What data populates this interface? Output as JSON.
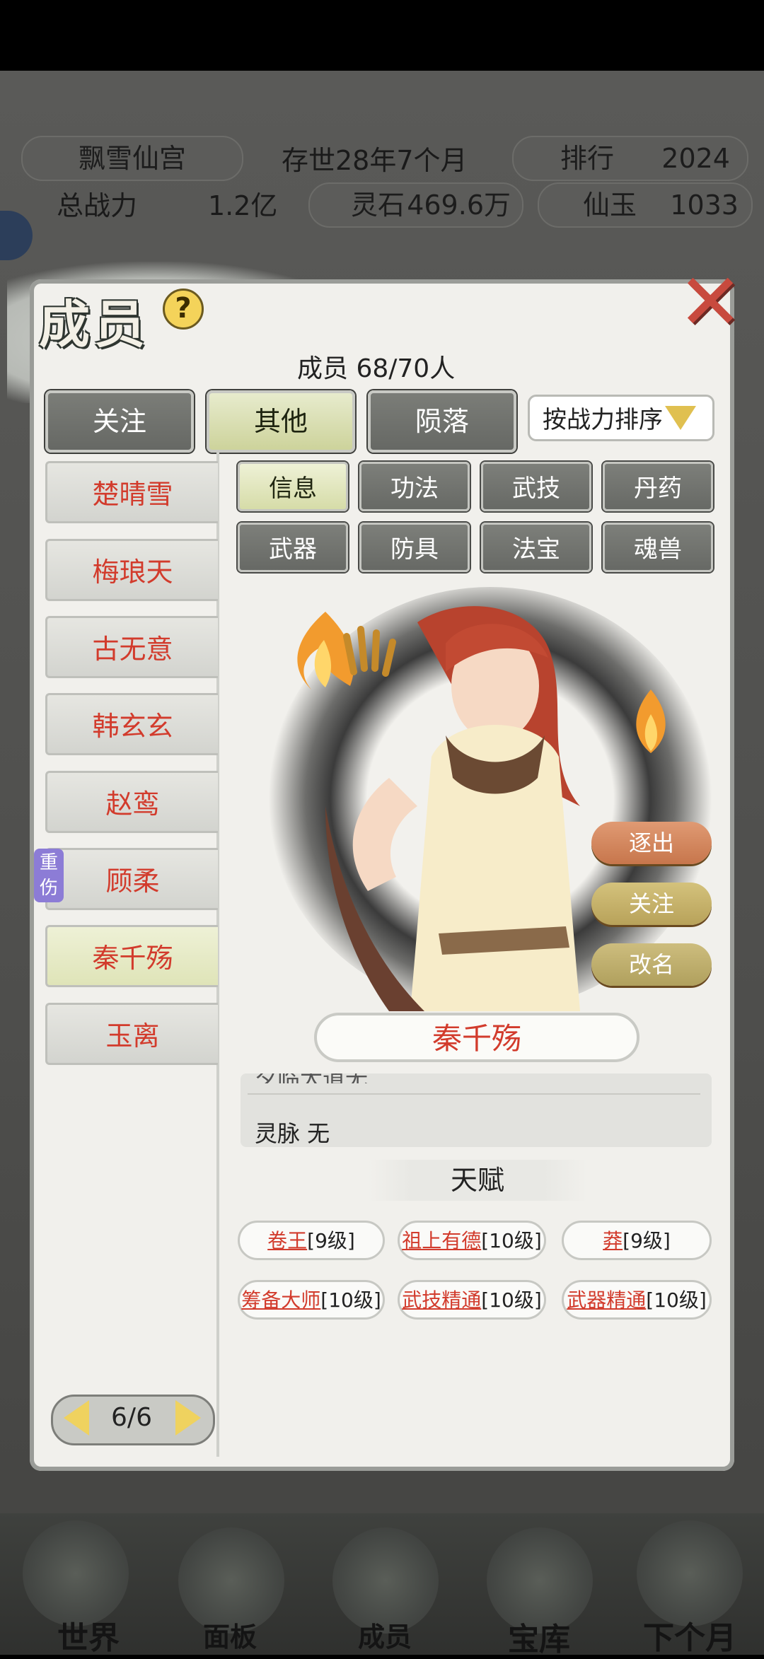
{
  "hud": {
    "sect_name": "飘雪仙宫",
    "age": "存世28年7个月",
    "rank_label": "排行",
    "rank_value": "2024",
    "power_label": "总战力",
    "power_value": "1.2亿",
    "stone_label": "灵石",
    "stone_value": "469.6万",
    "jade_label": "仙玉",
    "jade_value": "1033"
  },
  "panel": {
    "title": "成员",
    "help": "?",
    "close": "✕",
    "member_count": "成员  68/70人",
    "tabs": [
      "关注",
      "其他",
      "陨落"
    ],
    "active_tab": "其他",
    "sort_label": "按战力排序"
  },
  "members": [
    {
      "name": "楚晴雪"
    },
    {
      "name": "梅琅天"
    },
    {
      "name": "古无意"
    },
    {
      "name": "韩玄玄"
    },
    {
      "name": "赵鸾"
    },
    {
      "name": "顾柔",
      "badge": "重伤"
    },
    {
      "name": "秦千殇",
      "selected": true
    },
    {
      "name": "玉离"
    }
  ],
  "sub_tabs": [
    "信息",
    "功法",
    "武技",
    "丹药",
    "武器",
    "防具",
    "法宝",
    "魂兽"
  ],
  "active_sub_tab": "信息",
  "detail": {
    "name": "秦千殇",
    "actions": {
      "expel": "逐出",
      "follow": "关注",
      "rename": "改名"
    },
    "clipped_line": "夕临大道无",
    "spirit_vein": "灵脉 无",
    "talent_title": "天赋",
    "talents": [
      {
        "name": "卷王",
        "level": "[9级]"
      },
      {
        "name": "祖上有德",
        "level": "[10级]"
      },
      {
        "name": "莽",
        "level": "[9级]"
      },
      {
        "name": "筹备大师",
        "level": "[10级]"
      },
      {
        "name": "武技精通",
        "level": "[10级]"
      },
      {
        "name": "武器精通",
        "level": "[10级]"
      }
    ]
  },
  "pager": {
    "text": "6/6"
  },
  "bottom_nav": [
    "世界",
    "面板",
    "成员",
    "宝库",
    "下个月"
  ],
  "colors": {
    "name_red": "#d23b2c",
    "accent_gold": "#efd25f",
    "active_tab": "#dfe4b8"
  }
}
